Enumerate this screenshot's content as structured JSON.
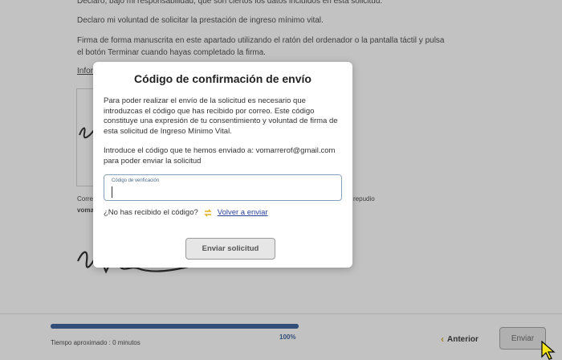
{
  "background": {
    "line1": "Declaro, bajo mi responsabilidad, que son ciertos los datos incluidos en esta solicitud.",
    "line2": "Declaro mi voluntad de solicitar la prestación de ingreso mínimo vital.",
    "line3": "Firma de forma manuscrita en este apartado utilizando el ratón del ordenador o la pantalla táctil y pulsa",
    "line4": "el botón Terminar cuando hayas completado la firma.",
    "link": "Infor",
    "small_left": "Corre",
    "small_left2": "voma",
    "small_right": "repudio"
  },
  "modal": {
    "title": "Código de confirmación de envío",
    "paragraph": "Para poder realizar el envío de la solicitud es necesario que introduzcas el código que has recibido por correo. Este código constituye una expresión de tu consentimiento y voluntad de firma de esta solicitud de Ingreso Mínimo Vital.",
    "paragraph2": "Introduce el código que te hemos enviado a: vomarrerof@gmail.com para poder enviar la solicitud",
    "code_label": "Código de verificación",
    "code_value": "",
    "resend_question": "¿No has recibido el código?",
    "resend_icon": "refresh-icon",
    "resend_link": "Volver a enviar",
    "submit_label": "Enviar solicitud"
  },
  "footer": {
    "progress_percent": 100,
    "progress_label": "100%",
    "time_label": "Tiempo aproximado : 0 minutos",
    "prev_chevron": "‹",
    "prev_label": "Anterior",
    "send_label": "Enviar"
  },
  "colors": {
    "progress": "#1f4e8c",
    "accent": "#e0b020",
    "link": "#2a3f9e"
  }
}
